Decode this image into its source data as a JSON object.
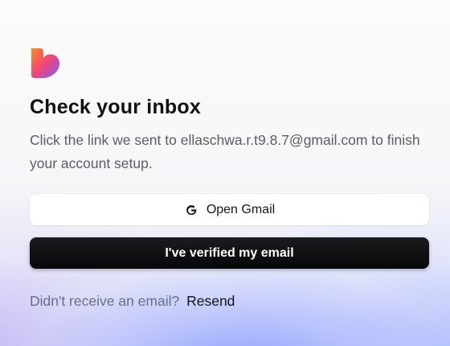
{
  "logo": {
    "icon": "heart-logo-icon",
    "gradient": [
      "#ff8a1f",
      "#f0457a",
      "#7a5cf5"
    ]
  },
  "page": {
    "title": "Check your inbox",
    "subtitle": "Click the link we sent to ellaschwa.r.t9.8.7@gmail.com to finish your account setup."
  },
  "actions": {
    "open_gmail": {
      "label": "Open Gmail",
      "icon": "google-g-icon"
    },
    "verified": {
      "label": "I've verified my email"
    }
  },
  "resend": {
    "prompt": "Didn't receive an email?",
    "link": "Resend"
  },
  "colors": {
    "accent_dark": "#0b0b0d",
    "muted_text": "#6a6f88",
    "background_glow": "#8fa0ff"
  }
}
